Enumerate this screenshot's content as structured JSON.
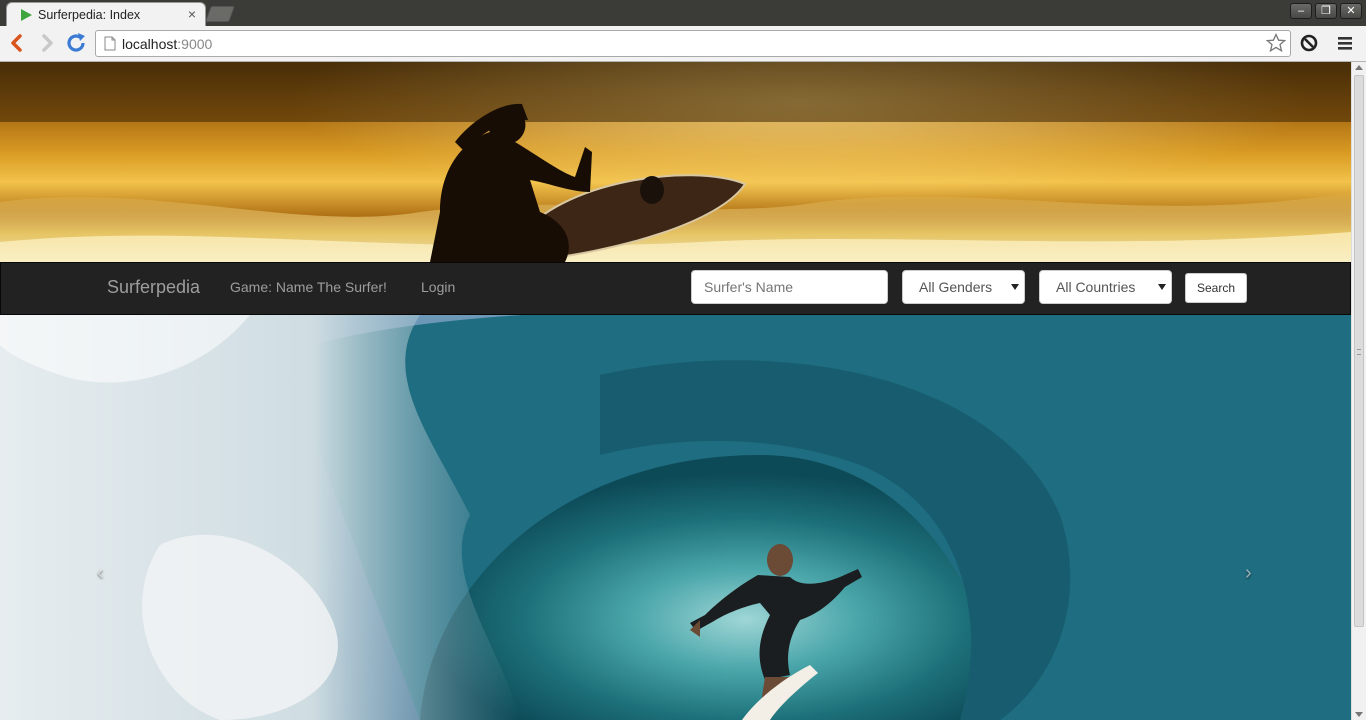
{
  "browser": {
    "tab_title": "Surferpedia: Index",
    "tab_close": "×",
    "url_host": "localhost",
    "url_port": ":9000",
    "window_buttons": [
      "–",
      "❐",
      "✕"
    ]
  },
  "navbar": {
    "brand": "Surferpedia",
    "links": [
      "Game: Name The Surfer!",
      "Login"
    ],
    "search_placeholder": "Surfer's Name",
    "gender_select": "All Genders",
    "country_select": "All Countries",
    "search_button": "Search"
  },
  "carousel": {
    "prev": "‹",
    "next": "›"
  },
  "colors": {
    "navbar_bg": "#222222",
    "nav_text": "#9d9d9d"
  }
}
